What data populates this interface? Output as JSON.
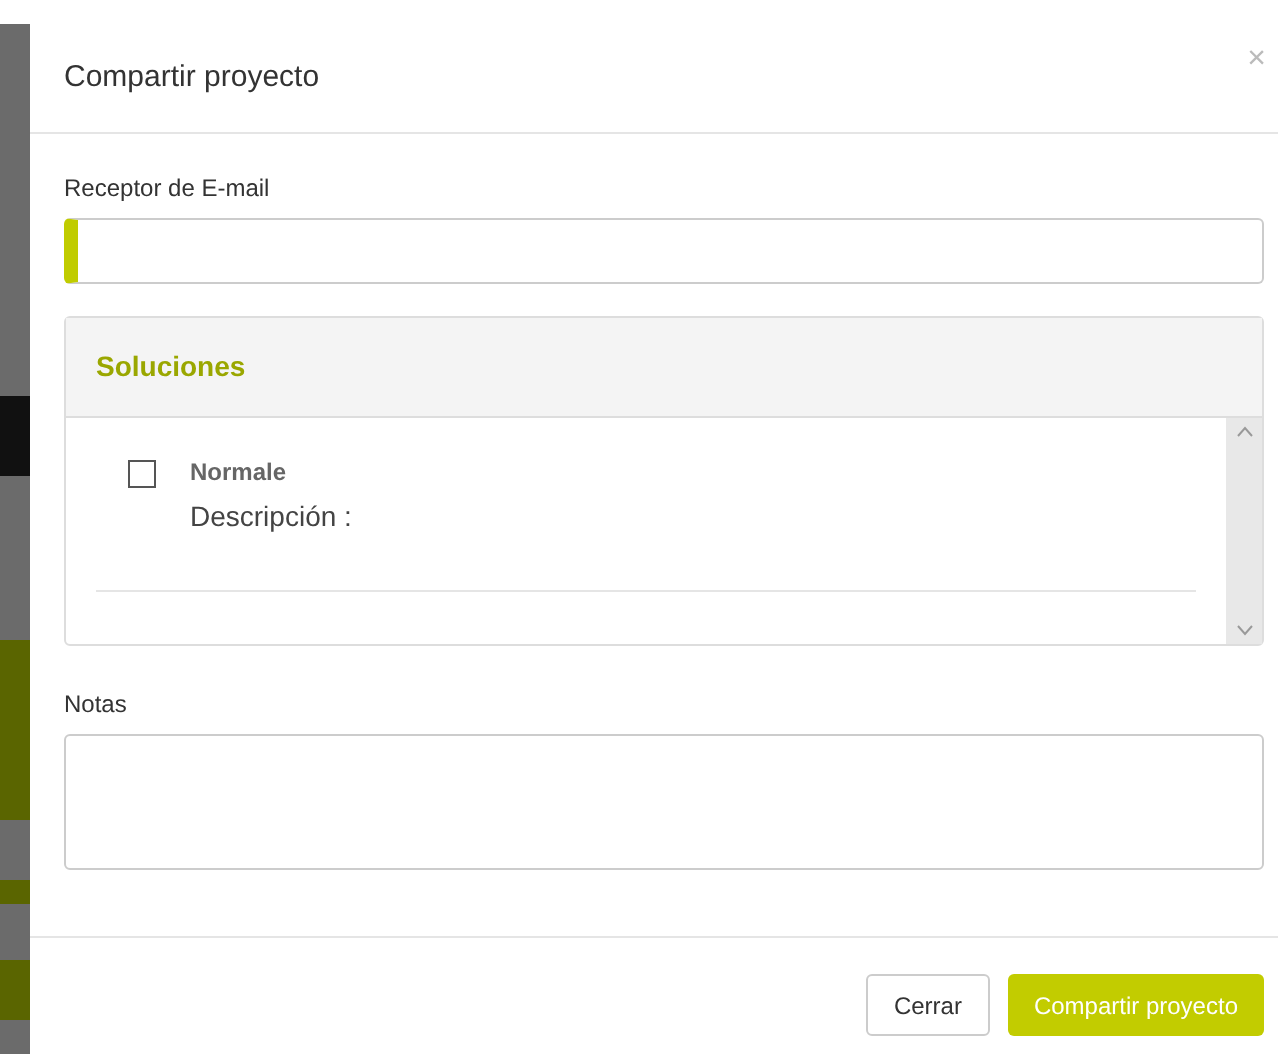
{
  "dialog": {
    "title": "Compartir proyecto",
    "close": "×"
  },
  "email": {
    "label": "Receptor de E-mail",
    "required": true
  },
  "solutions": {
    "title": "Soluciones",
    "items": [
      {
        "name": "Normale",
        "description": "Descripción :",
        "checked": false
      }
    ]
  },
  "notes": {
    "label": "Notas"
  },
  "buttons": [
    {
      "label": "Cerrar",
      "kind": "secondary"
    },
    {
      "label": "Compartir proyecto",
      "kind": "primary"
    }
  ]
}
